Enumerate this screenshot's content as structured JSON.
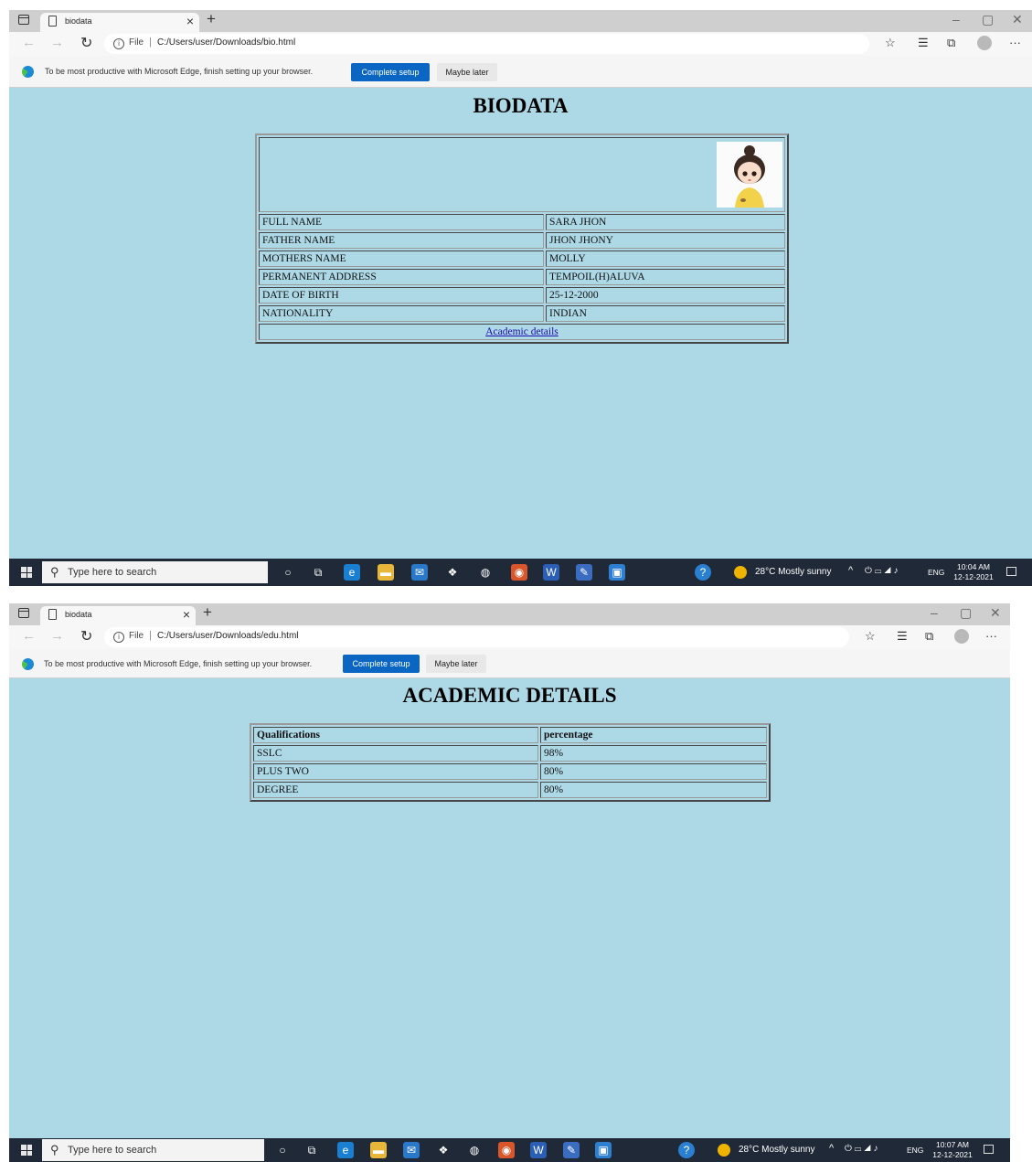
{
  "screens": [
    {
      "tab_title": "biodata",
      "url_prefix": "File",
      "url": "C:/Users/user/Downloads/bio.html",
      "infobar_message": "To be most productive with Microsoft Edge, finish setting up your browser.",
      "complete_setup": "Complete setup",
      "maybe_later": "Maybe later",
      "heading": "BIODATA",
      "rows": [
        {
          "label": "FULL NAME",
          "value": "SARA JHON"
        },
        {
          "label": "FATHER NAME",
          "value": "JHON JHONY"
        },
        {
          "label": "MOTHERS NAME",
          "value": "MOLLY"
        },
        {
          "label": "PERMANENT ADDRESS",
          "value": "TEMPOIL(H)ALUVA"
        },
        {
          "label": "DATE OF BIRTH",
          "value": "25-12-2000"
        },
        {
          "label": "NATIONALITY",
          "value": "INDIAN"
        }
      ],
      "link_text": "Academic details",
      "taskbar": {
        "search_placeholder": "Type here to search",
        "weather": "28°C Mostly sunny",
        "language": "ENG",
        "time": "10:04 AM",
        "date": "12-12-2021"
      }
    },
    {
      "tab_title": "biodata",
      "url_prefix": "File",
      "url": "C:/Users/user/Downloads/edu.html",
      "infobar_message": "To be most productive with Microsoft Edge, finish setting up your browser.",
      "complete_setup": "Complete setup",
      "maybe_later": "Maybe later",
      "heading": "ACADEMIC DETAILS",
      "table_headers": [
        "Qualifications",
        "percentage"
      ],
      "table_rows": [
        [
          "SSLC",
          "98%"
        ],
        [
          "PLUS TWO",
          "80%"
        ],
        [
          "DEGREE",
          "80%"
        ]
      ],
      "taskbar": {
        "search_placeholder": "Type here to search",
        "weather": "28°C Mostly sunny",
        "language": "ENG",
        "time": "10:07 AM",
        "date": "12-12-2021"
      }
    }
  ],
  "icons": [
    "tab-actions-icon",
    "page-icon",
    "close-icon",
    "new-tab-icon",
    "back-icon",
    "forward-icon",
    "refresh-icon",
    "info-icon",
    "favorites-add-icon",
    "favorites-icon",
    "collections-icon",
    "profile-icon",
    "more-icon",
    "edge-logo-icon",
    "windows-start-icon",
    "search-icon",
    "cortana-icon",
    "task-view-icon"
  ],
  "colors": {
    "page_background": "#add8e6",
    "primary_button": "#0a66c2",
    "taskbar": "#1f2937",
    "link": "#1a0dab"
  }
}
